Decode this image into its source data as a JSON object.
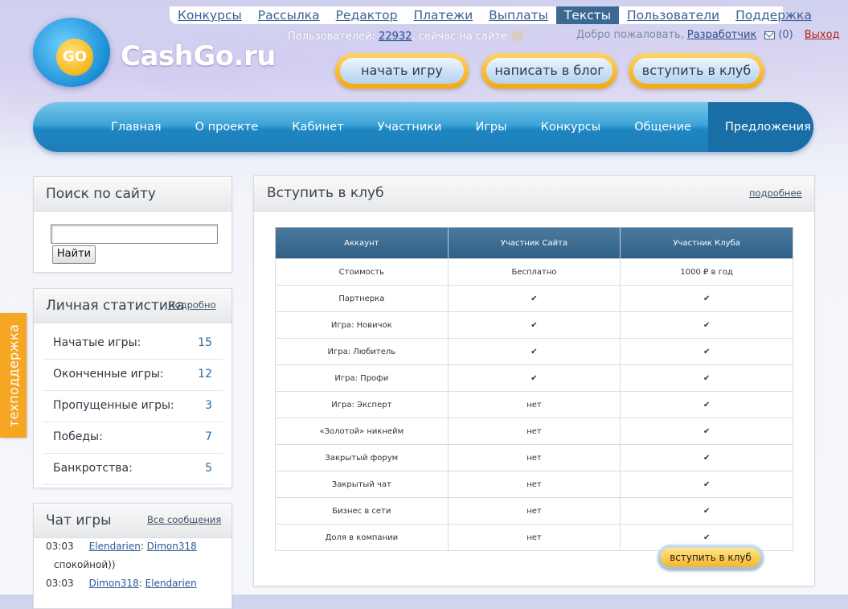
{
  "top_nav": [
    "Конкурсы",
    "Рассылка",
    "Редактор",
    "Платежи",
    "Выплаты",
    "Тексты",
    "Пользователи",
    "Поддержка"
  ],
  "top_nav_active": "Тексты",
  "logo": {
    "coin": "GO",
    "text": "CashGo.ru"
  },
  "users": {
    "prefix": "Пользователей:",
    "total": "22932",
    "middle": ", сейчас на сайте",
    "online": "22"
  },
  "welcome": {
    "text": "Добро пожаловать,",
    "user": "Разработчик",
    "messages": "(0)",
    "logout": "Выход"
  },
  "actions": [
    "начать игру",
    "написать в блог",
    "вступить в клуб"
  ],
  "main_nav": [
    "Главная",
    "О проекте",
    "Кабинет",
    "Участники",
    "Игры",
    "Конкурсы",
    "Общение",
    "Предложения"
  ],
  "main_nav_active": "Предложения",
  "search": {
    "title": "Поиск по сайту",
    "value": "",
    "button": "Найти"
  },
  "stats": {
    "title": "Личная статистика",
    "link": "Подробно",
    "rows": [
      {
        "label": "Начатые игры:",
        "value": "15"
      },
      {
        "label": "Оконченные игры:",
        "value": "12"
      },
      {
        "label": "Пропущенные игры:",
        "value": "3"
      },
      {
        "label": "Победы:",
        "value": "7"
      },
      {
        "label": "Банкротства:",
        "value": "5"
      }
    ]
  },
  "chat": {
    "title": "Чат игры",
    "link": "Все сообщения",
    "messages": [
      {
        "time": "03:03",
        "from": "Elendarien",
        "to": "Dimon318",
        "text": "спокойной))"
      },
      {
        "time": "03:03",
        "from": "Dimon318",
        "to": "Elendarien",
        "text": ""
      }
    ]
  },
  "tech_support": "техподдержка",
  "club": {
    "title": "Вступить в клуб",
    "more": "подробнее",
    "headers": [
      "Аккаунт",
      "Участник Сайта",
      "Участник Клуба"
    ],
    "rows": [
      [
        "Стоимость",
        "Бесплатно",
        "1000 ₽ в год"
      ],
      [
        "Партнерка",
        "✔",
        "✔"
      ],
      [
        "Игра: Новичок",
        "✔",
        "✔"
      ],
      [
        "Игра: Любитель",
        "✔",
        "✔"
      ],
      [
        "Игра: Профи",
        "✔",
        "✔"
      ],
      [
        "Игра: Эксперт",
        "нет",
        "✔"
      ],
      [
        "«Золотой» никнейм",
        "нет",
        "✔"
      ],
      [
        "Закрытый форум",
        "нет",
        "✔"
      ],
      [
        "Закрытый чат",
        "нет",
        "✔"
      ],
      [
        "Бизнес в сети",
        "нет",
        "✔"
      ],
      [
        "Доля в компании",
        "нет",
        "✔"
      ]
    ],
    "button": "вступить в клуб"
  }
}
